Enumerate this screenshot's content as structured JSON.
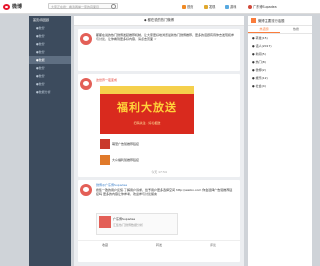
{
  "topbar": {
    "logo": "微博",
    "search_placeholder": "大家正在搜：看清两岸一家的真面目",
    "nav": [
      {
        "label": "首页",
        "color": "#f08a24"
      },
      {
        "label": "发现",
        "color": "#e0a82e"
      },
      {
        "label": "游戏",
        "color": "#58a9e0"
      },
      {
        "label": "广东博Supadea",
        "color": "#d04a3b"
      }
    ]
  },
  "sidebar": {
    "items": [
      {
        "label": "首页/待回顾"
      },
      {
        "label": "●数智"
      },
      {
        "label": "●数智"
      },
      {
        "label": "●数智"
      },
      {
        "label": "●数智"
      },
      {
        "label": "●数据"
      },
      {
        "label": "●数智"
      },
      {
        "label": "●数智"
      },
      {
        "label": "●数智"
      },
      {
        "label": "●数据分析"
      }
    ]
  },
  "feed": {
    "title": "◆ 都在说的热门微博",
    "post1": {
      "text": "都都在说的热门微博发起推荐机制，让大家更好地浏览最新热门微博推荐，更多的话题有待你去发现和参与讨论，让你看到更多好内容、请点击页面 ☆"
    },
    "post2": {
      "header": "这世界一夜变成",
      "banner_title": "福利大放送",
      "banner_sub": "扫码关注 · 好礼相送",
      "thumb1": "萌宠广告赞推荐链接",
      "thumb2": "大众福利赞推荐链接",
      "time": "今天 17:54"
    },
    "post3": {
      "author": "微博@广东博Supadea",
      "text": "搜集一致的用户反馈·了解用户诉求，给予用户更多选择空间 http://weibo.com 你会选择广告赞推荐链接吗 更多的内容让你参考，欢迎参与讨论留言",
      "quote_title": "广东博Supadea",
      "quote_text": "汇集热门微博数据分析",
      "actions": [
        "收藏",
        "转发",
        "评论"
      ]
    }
  },
  "right": {
    "title": "微博主要流行话题",
    "tabs": [
      "热话题",
      "热搜"
    ],
    "items": [
      "● 转发(15)",
      "● 话人(2017)",
      "● 新闻(5)",
      "● 热门(8)",
      "● 微博(2)",
      "● 娱乐(12)",
      "● 社会(4)"
    ]
  }
}
